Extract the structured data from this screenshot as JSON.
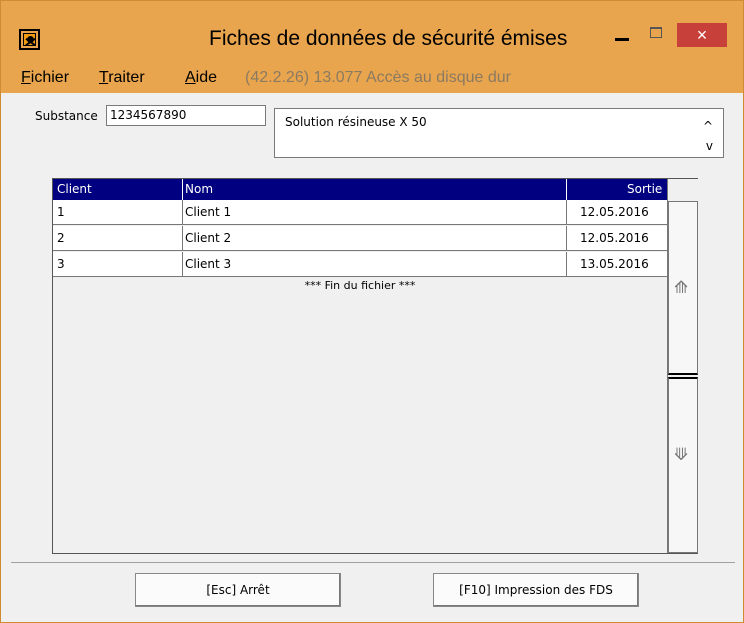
{
  "window": {
    "title": "Fiches de données de sécurité émises",
    "close_label": "×"
  },
  "menu": {
    "items": [
      {
        "underline": "F",
        "rest": "ichier"
      },
      {
        "underline": "T",
        "rest": "raiter"
      },
      {
        "underline": "A",
        "rest": "ide"
      }
    ],
    "status": "(42.2.26) 13.077 Accès au disque dur"
  },
  "form": {
    "substance_label": "Substance",
    "substance_value": "1234567890",
    "description": "Solution résineuse X 50",
    "scroll_up": "^",
    "scroll_down": "v"
  },
  "table": {
    "headers": [
      "Client",
      "Nom",
      "Sortie"
    ],
    "rows": [
      {
        "client": "1",
        "nom": "Client 1",
        "sortie": "12.05.2016"
      },
      {
        "client": "2",
        "nom": "Client 2",
        "sortie": "12.05.2016"
      },
      {
        "client": "3",
        "nom": "Client 3",
        "sortie": "13.05.2016"
      }
    ],
    "end_text": "*** Fin du fichier ***",
    "scroll_up_glyph": "⟰",
    "scroll_down_glyph": "⟱"
  },
  "buttons": {
    "stop": "[Esc] Arrêt",
    "print": "[F10] Impression des FDS"
  },
  "colors": {
    "title_bar": "#e9a54d",
    "header": "#000080",
    "close": "#c7413a"
  }
}
